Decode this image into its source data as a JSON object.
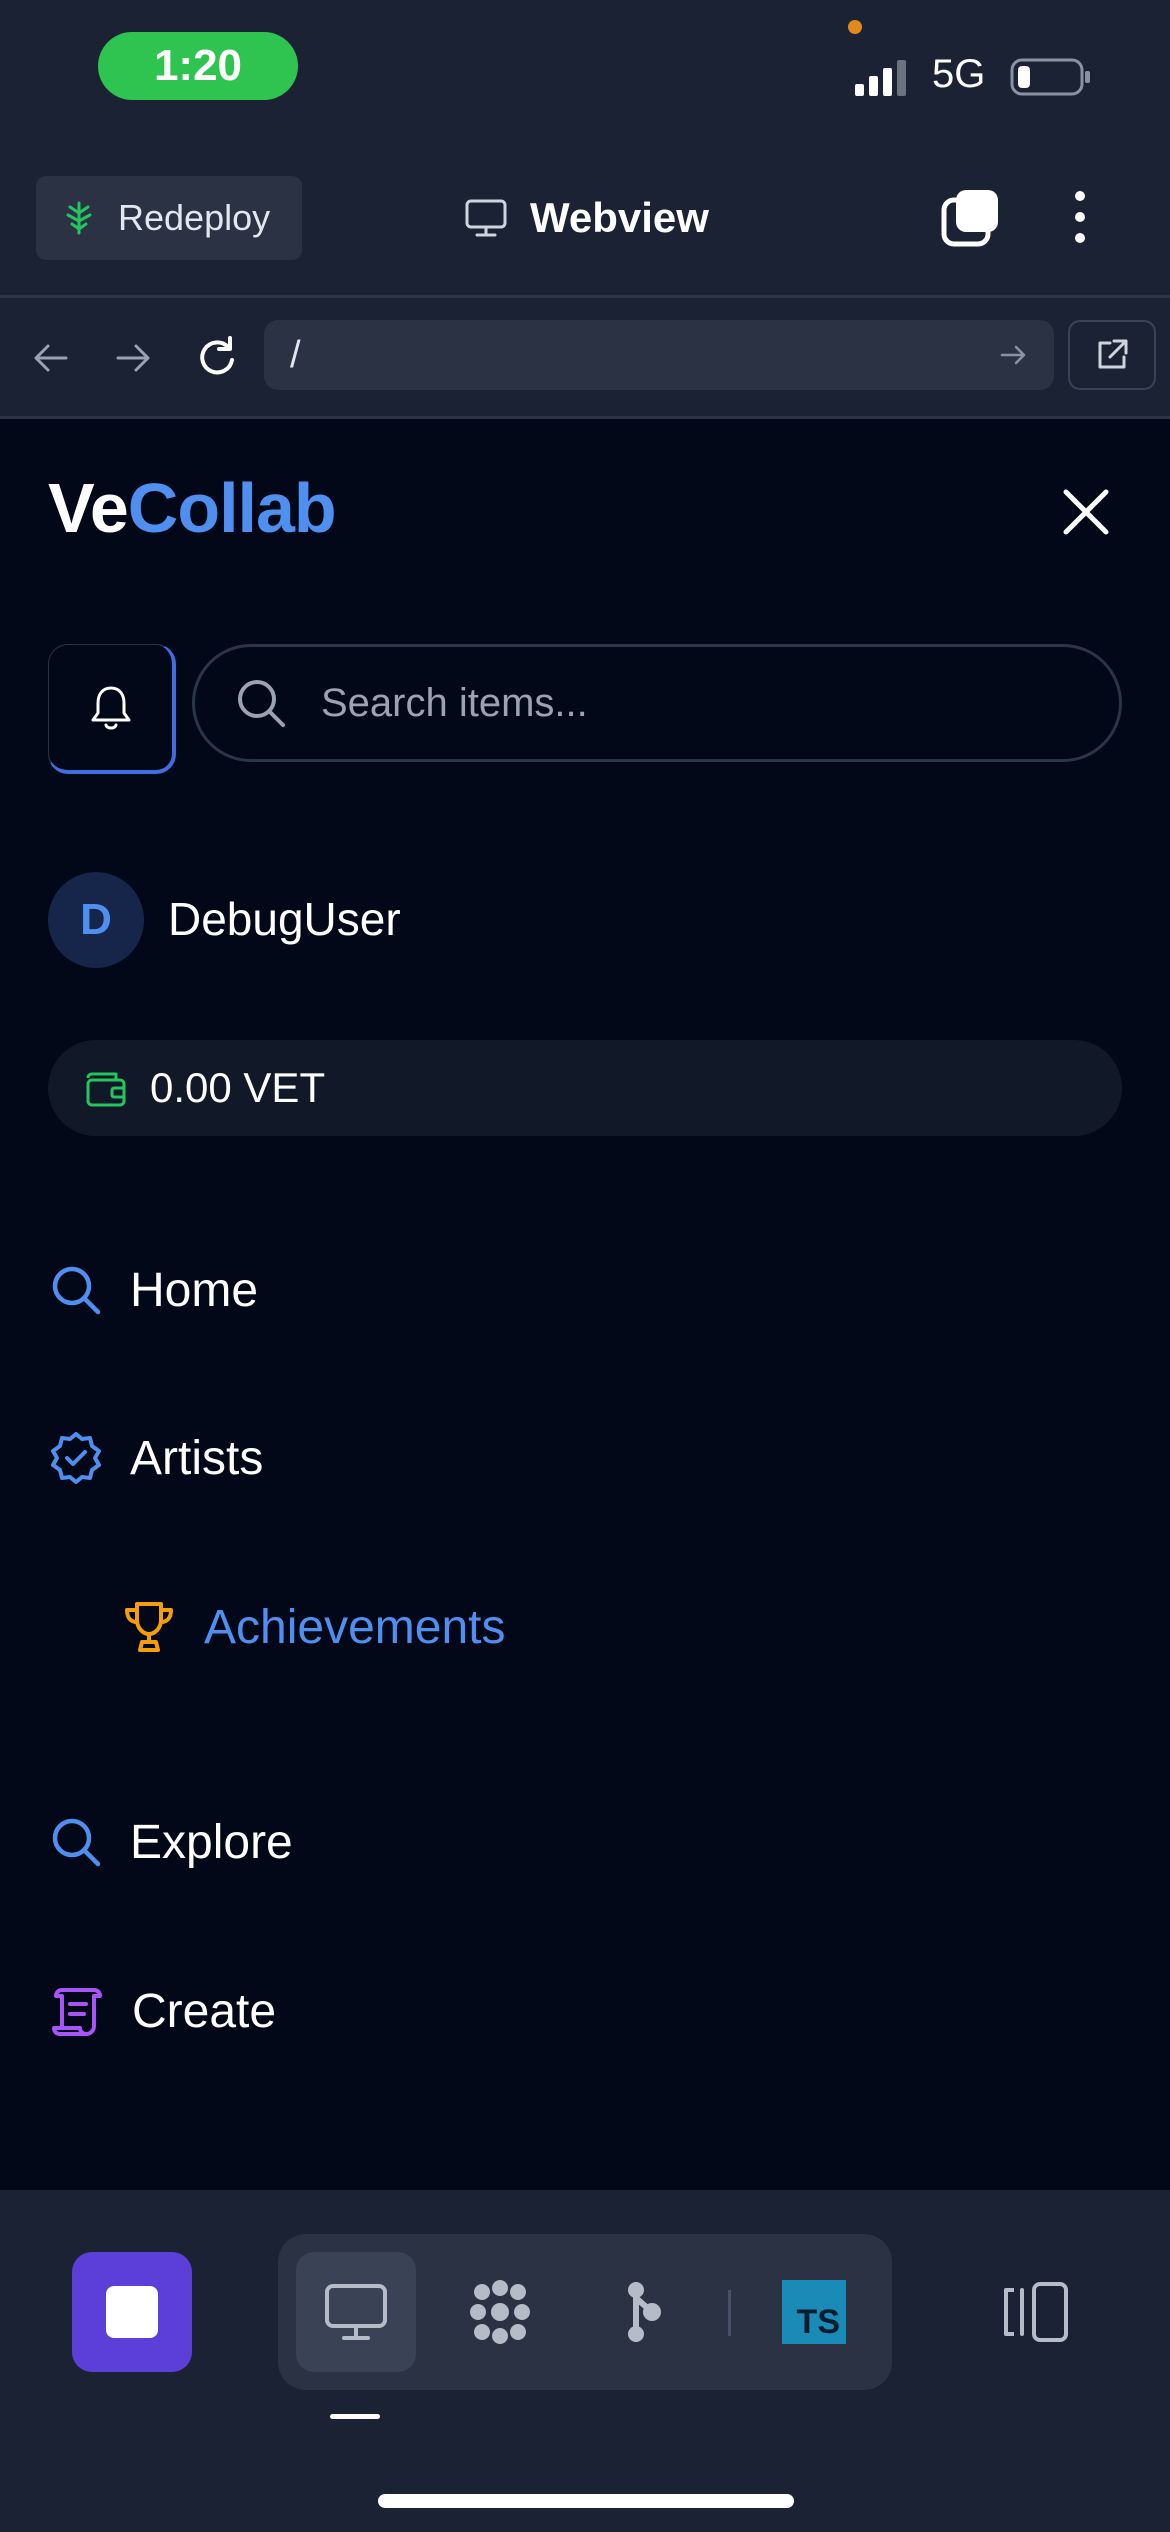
{
  "status_bar": {
    "time": "1:20",
    "network": "5G"
  },
  "toolbar": {
    "redeploy_label": "Redeploy",
    "title": "Webview"
  },
  "navigation": {
    "url": "/"
  },
  "app": {
    "logo_part1": "Ve",
    "logo_part2": "Collab",
    "search_placeholder": "Search items...",
    "user": {
      "initial": "D",
      "name": "DebugUser"
    },
    "wallet_balance": "0.00 VET",
    "menu": [
      {
        "label": "Home",
        "icon": "search-icon"
      },
      {
        "label": "Artists",
        "icon": "verified-badge-icon"
      },
      {
        "label": "Achievements",
        "icon": "trophy-icon"
      },
      {
        "label": "Explore",
        "icon": "search-icon"
      },
      {
        "label": "Create",
        "icon": "scroll-icon"
      }
    ]
  },
  "bottom_bar": {
    "ts_badge": "TS"
  },
  "colors": {
    "background": "#020817",
    "chrome": "#1b2233",
    "accent_blue": "#4f8ff0",
    "time_pill": "#2fc450",
    "wallet_green": "#22c55e",
    "trophy_orange": "#f59e0b",
    "create_purple": "#a855f7",
    "stop_button": "#5b3fd8"
  }
}
